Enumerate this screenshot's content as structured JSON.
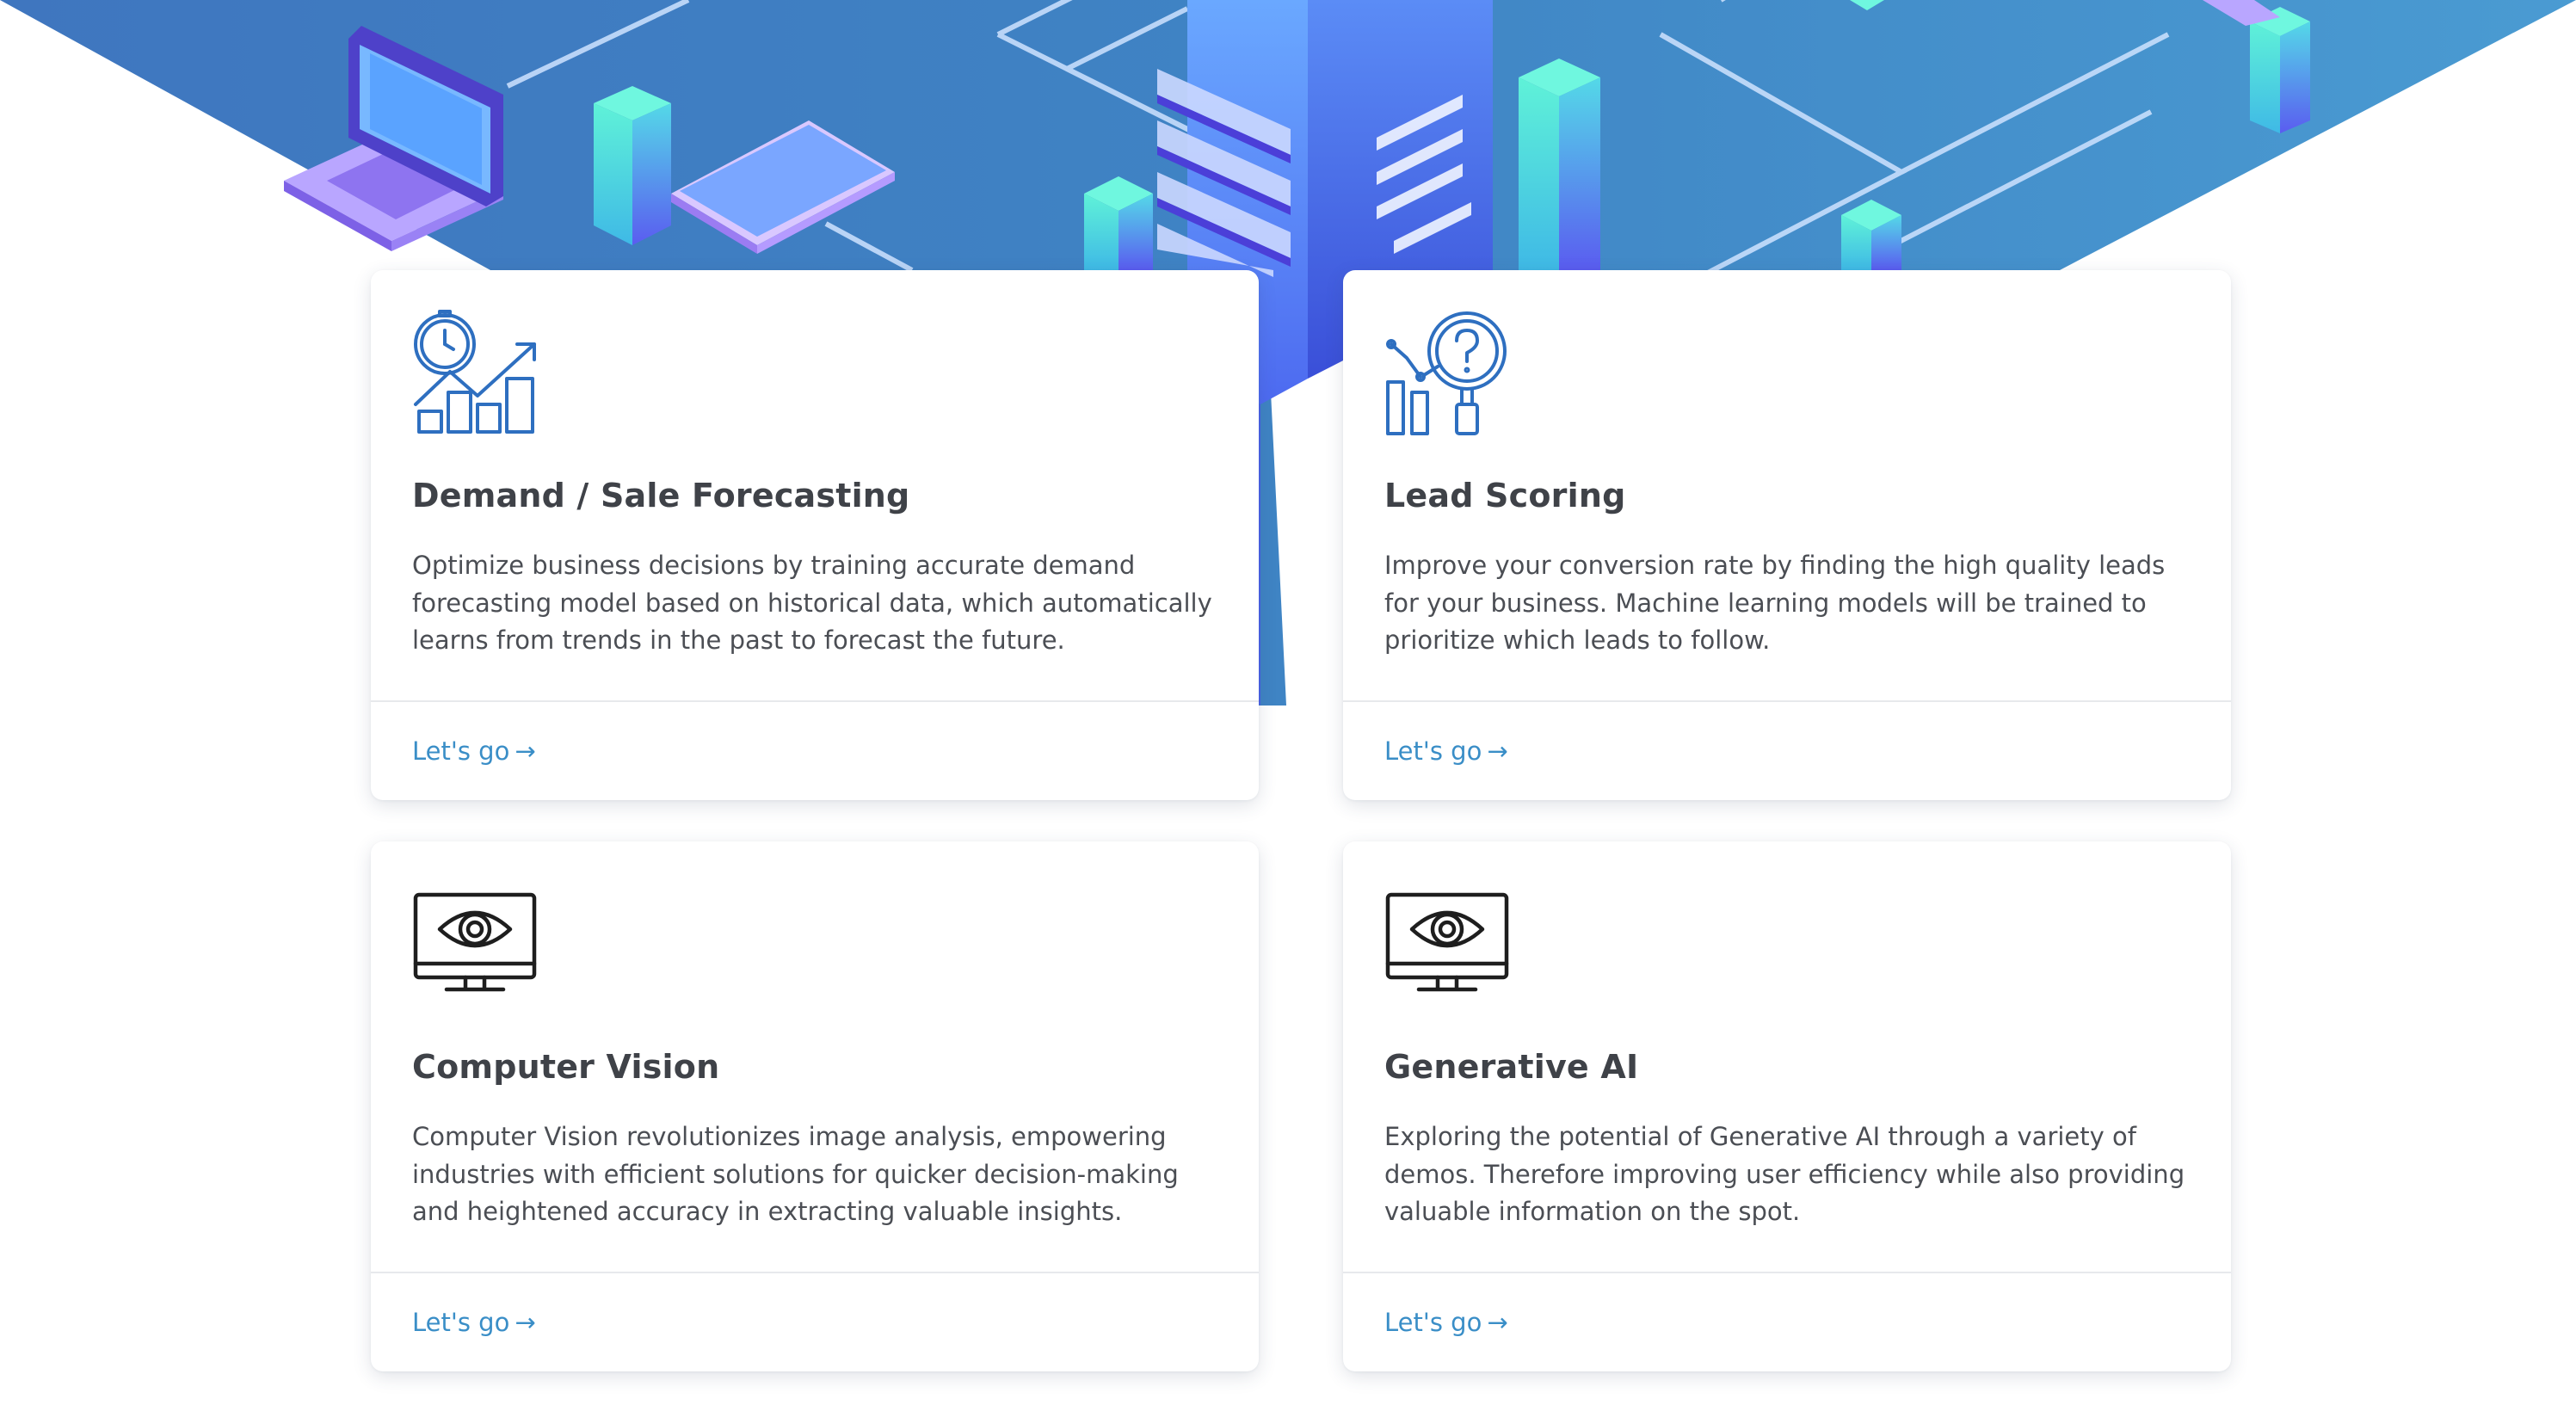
{
  "colors": {
    "hero_blue": "#3f7fc2",
    "link": "#3a8ec7",
    "title": "#3f4248",
    "text": "#4b4e54",
    "icon_blue": "#2e6fc0",
    "icon_dark": "#1e1e1e"
  },
  "cards": [
    {
      "icon": "forecast-chart-icon",
      "title": "Demand / Sale Forecasting",
      "description": "Optimize business decisions by training accurate demand forecasting model based on historical data, which automatically learns from trends in the past to forecast the future.",
      "link_label": "Let's go",
      "link_arrow": "→"
    },
    {
      "icon": "lead-magnifier-icon",
      "title": "Lead Scoring",
      "description": "Improve your conversion rate by finding the high quality leads for your business. Machine learning models will be trained to prioritize which leads to follow.",
      "link_label": "Let's go",
      "link_arrow": "→"
    },
    {
      "icon": "monitor-eye-icon",
      "title": "Computer Vision",
      "description": "Computer Vision revolutionizes image analysis, empowering industries with efficient solutions for quicker decision-making and heightened accuracy in extracting valuable insights.",
      "link_label": "Let's go",
      "link_arrow": "→"
    },
    {
      "icon": "monitor-eye-icon",
      "title": "Generative AI",
      "description": "Exploring the potential of Generative AI through a variety of demos. Therefore improving user efficiency while also providing valuable information on the spot.",
      "link_label": "Let's go",
      "link_arrow": "→"
    }
  ]
}
